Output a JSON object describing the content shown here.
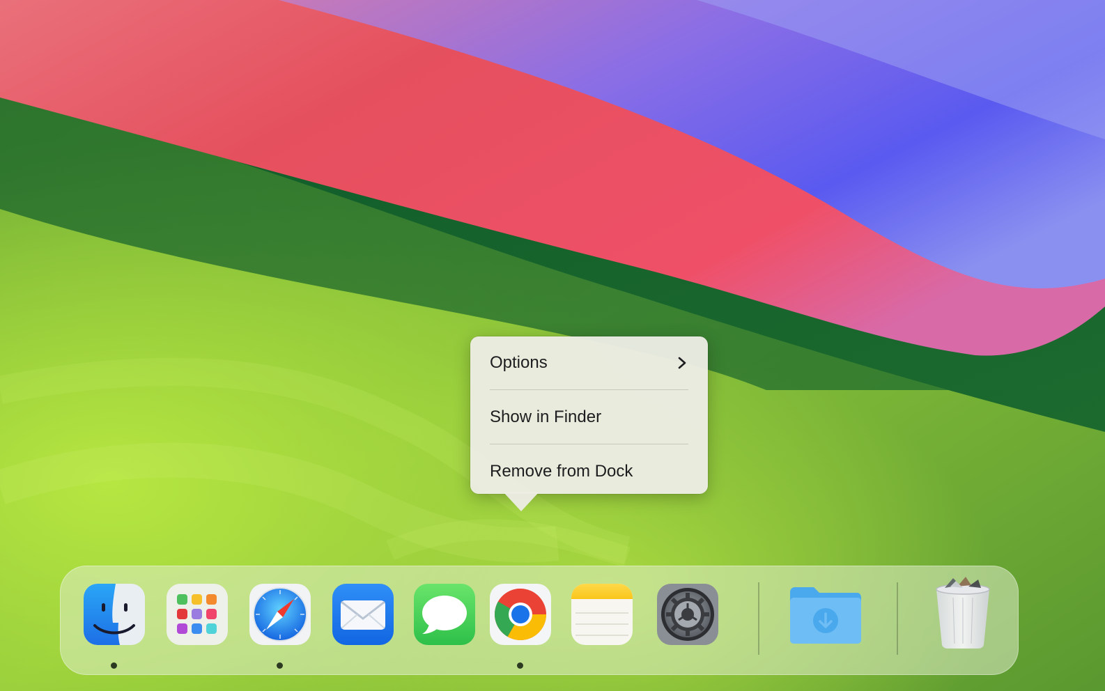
{
  "context_menu": {
    "items": [
      {
        "label": "Options",
        "has_submenu": true,
        "icon": "chevron-right-icon"
      },
      {
        "label": "Show in Finder",
        "has_submenu": false
      },
      {
        "label": "Remove from Dock",
        "has_submenu": false
      }
    ]
  },
  "dock": {
    "apps": [
      {
        "name": "Finder",
        "icon": "finder-icon",
        "running": true
      },
      {
        "name": "Launchpad",
        "icon": "launchpad-icon",
        "running": false
      },
      {
        "name": "Safari",
        "icon": "safari-icon",
        "running": true
      },
      {
        "name": "Mail",
        "icon": "mail-icon",
        "running": false
      },
      {
        "name": "Messages",
        "icon": "messages-icon",
        "running": false
      },
      {
        "name": "Google Chrome",
        "icon": "chrome-icon",
        "running": true
      },
      {
        "name": "Notes",
        "icon": "notes-icon",
        "running": false
      },
      {
        "name": "System Settings",
        "icon": "gear-icon",
        "running": false
      }
    ],
    "stacks": [
      {
        "name": "Downloads",
        "icon": "downloads-folder-icon"
      }
    ],
    "trash": {
      "name": "Trash",
      "icon": "trash-icon",
      "full": true
    }
  },
  "wallpaper": {
    "name": "macOS Sonoma",
    "colors": {
      "green": "#1e6b2e",
      "red": "#e5505e",
      "purple": "#7a6ae8",
      "lime": "#9ccc3a"
    }
  }
}
